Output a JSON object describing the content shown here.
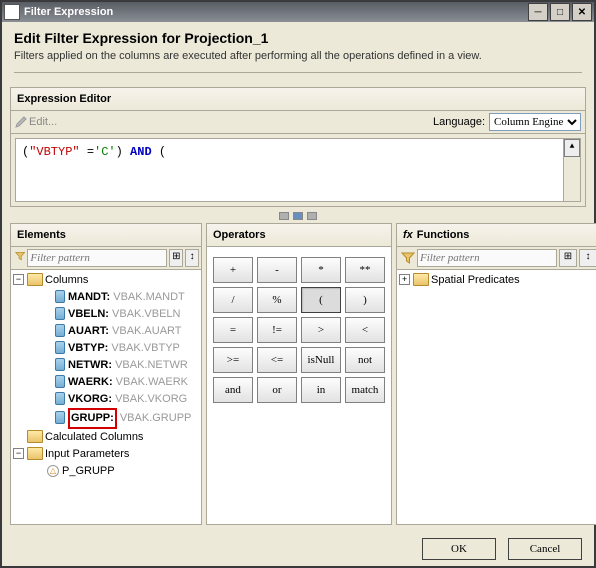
{
  "window": {
    "title": "Filter Expression"
  },
  "header": {
    "title": "Edit Filter Expression for Projection_1",
    "subtitle": "Filters applied on the columns are executed after performing all the operations defined in a view."
  },
  "editor": {
    "title": "Expression Editor",
    "edit": "Edit...",
    "language_label": "Language:",
    "language_value": "Column Engine",
    "code": {
      "p1": "(",
      "col": "\"VBTYP\"",
      "eq": " =",
      "str": "'C'",
      "p2": ") ",
      "kw": "AND",
      "p3": " ("
    }
  },
  "elements": {
    "title": "Elements",
    "filter_placeholder": "Filter pattern",
    "root": "Columns",
    "cols": [
      {
        "name": "MANDT:",
        "src": "VBAK.MANDT"
      },
      {
        "name": "VBELN:",
        "src": "VBAK.VBELN"
      },
      {
        "name": "AUART:",
        "src": "VBAK.AUART"
      },
      {
        "name": "VBTYP:",
        "src": "VBAK.VBTYP"
      },
      {
        "name": "NETWR:",
        "src": "VBAK.NETWR"
      },
      {
        "name": "WAERK:",
        "src": "VBAK.WAERK"
      },
      {
        "name": "VKORG:",
        "src": "VBAK.VKORG"
      },
      {
        "name": "GRUPP:",
        "src": "VBAK.GRUPP"
      }
    ],
    "calc": "Calculated Columns",
    "input": "Input Parameters",
    "param": "P_GRUPP"
  },
  "operators": {
    "title": "Operators",
    "btns": [
      "+",
      "-",
      "*",
      "**",
      "/",
      "%",
      "(",
      ")",
      "=",
      "!=",
      ">",
      "<",
      ">=",
      "<=",
      "isNull",
      "not",
      "and",
      "or",
      "in",
      "match"
    ],
    "selected": "("
  },
  "functions": {
    "title": "Functions",
    "filter_placeholder": "Filter pattern",
    "item": "Spatial Predicates"
  },
  "buttons": {
    "ok": "OK",
    "cancel": "Cancel"
  }
}
